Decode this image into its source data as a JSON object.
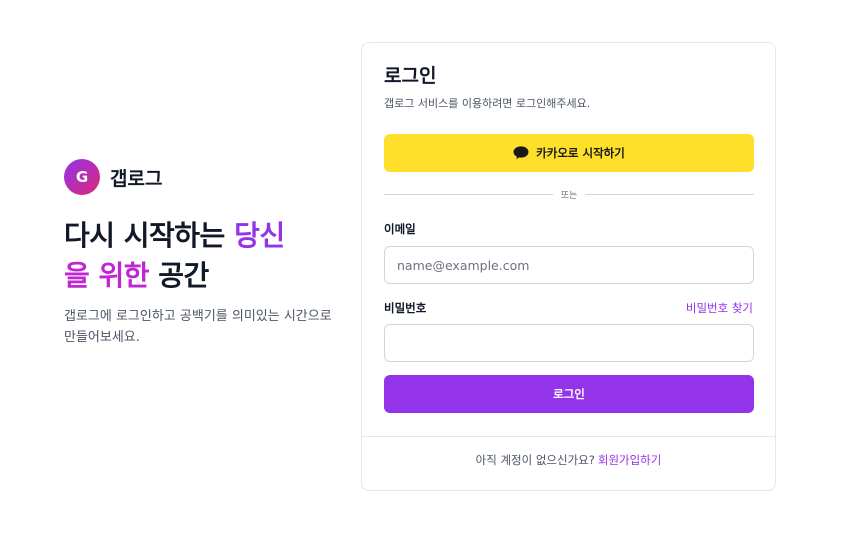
{
  "brand": {
    "logo_letter": "G",
    "name": "갭로그"
  },
  "hero": {
    "headline_part1": "다시 시작하는 ",
    "headline_highlight1": "당신",
    "headline_highlight2": "을 위한",
    "headline_part2": " 공간",
    "description": "갭로그에 로그인하고 공백기를 의미있는 시간으로 만들어보세요."
  },
  "login": {
    "title": "로그인",
    "subtitle": "갭로그 서비스를 이용하려면 로그인해주세요.",
    "kakao_button": "카카오로 시작하기",
    "divider": "또는",
    "email_label": "이메일",
    "email_placeholder": "name@example.com",
    "email_value": "",
    "password_label": "비밀번호",
    "forgot_password": "비밀번호 찾기",
    "password_value": "",
    "submit_button": "로그인",
    "footer_text": "아직 계정이 없으신가요?",
    "signup_link": "회원가입하기"
  },
  "colors": {
    "accent": "#9333ea",
    "accent_pink": "#c026d3",
    "kakao": "#fee02b",
    "text": "#111827",
    "muted": "#4b5563",
    "border": "#e5e7eb"
  },
  "icons": {
    "kakao": "speech-bubble-icon"
  }
}
